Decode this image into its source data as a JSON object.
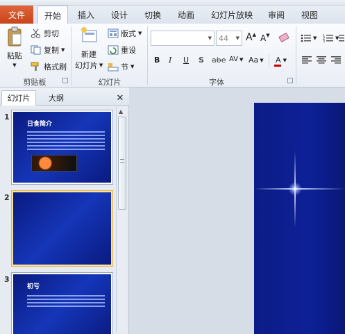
{
  "ribbon_tabs": {
    "file": "文件",
    "home": "开始",
    "insert": "插入",
    "design": "设计",
    "transitions": "切换",
    "animations": "动画",
    "slideshow": "幻灯片放映",
    "review": "审阅",
    "view": "视图"
  },
  "clipboard": {
    "paste": "粘贴",
    "cut": "剪切",
    "copy": "复制",
    "format_painter": "格式刷",
    "label": "剪贴板"
  },
  "slides": {
    "new_slide_line1": "新建",
    "new_slide_line2": "幻灯片",
    "layout": "版式",
    "reset": "重设",
    "section": "节",
    "label": "幻灯片"
  },
  "font": {
    "font_name": "",
    "font_size": "44",
    "grow": "A",
    "shrink": "A",
    "bold": "B",
    "italic": "I",
    "underline": "U",
    "shadow": "S",
    "strike": "abe",
    "spacing": "AV",
    "case": "Aa",
    "color": "A",
    "label": "字体"
  },
  "panel": {
    "tab_slides": "幻灯片",
    "tab_outline": "大纲",
    "close": "✕",
    "slides": [
      {
        "num": "1",
        "title": "日食简介"
      },
      {
        "num": "2",
        "title": ""
      },
      {
        "num": "3",
        "title": "初亏"
      }
    ]
  },
  "colors": {
    "file_tab": "#c8451a",
    "slide_bg": "#0d2097",
    "selected_border": "#e1b14a"
  }
}
